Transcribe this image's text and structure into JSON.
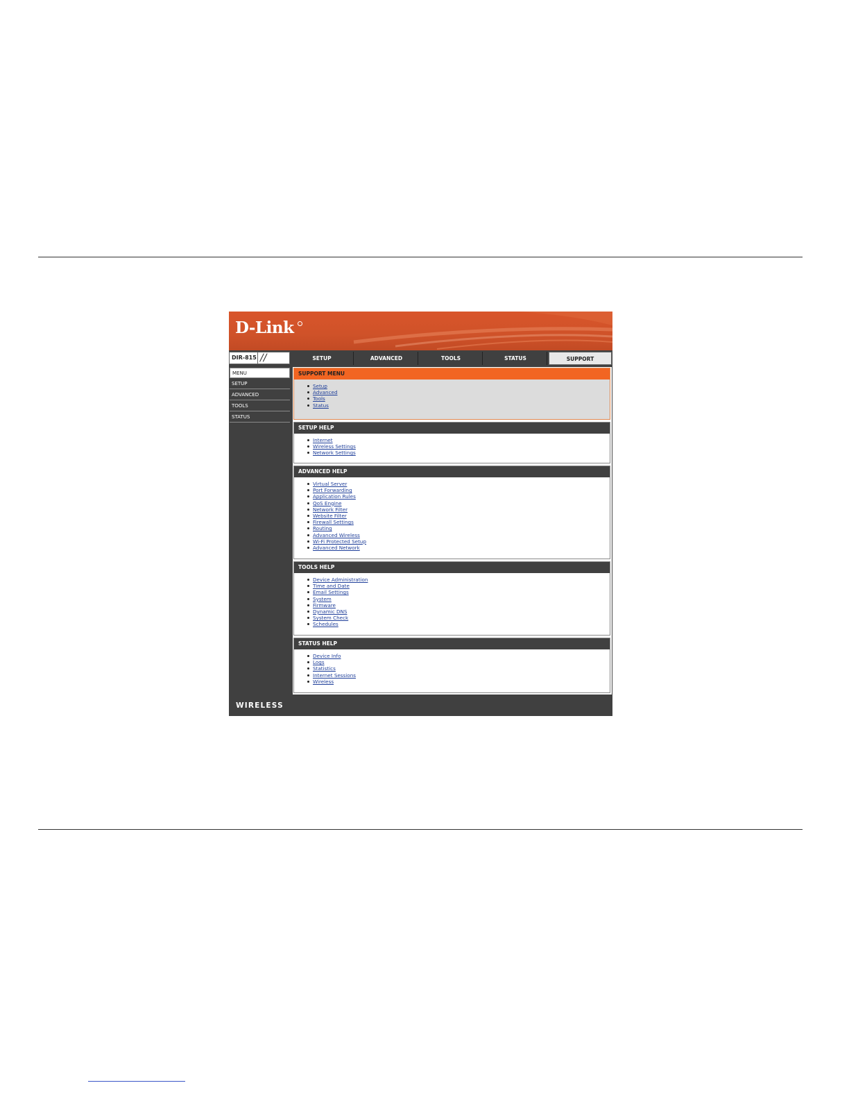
{
  "brand": {
    "logo": "D-Link",
    "model": "DIR-815",
    "footer": "WIRELESS"
  },
  "nav": {
    "tabs": [
      {
        "label": "SETUP",
        "active": false
      },
      {
        "label": "ADVANCED",
        "active": false
      },
      {
        "label": "TOOLS",
        "active": false
      },
      {
        "label": "STATUS",
        "active": false
      },
      {
        "label": "SUPPORT",
        "active": true
      }
    ]
  },
  "sidebar": {
    "items": [
      {
        "label": "MENU",
        "active": true
      },
      {
        "label": "SETUP",
        "active": false
      },
      {
        "label": "ADVANCED",
        "active": false
      },
      {
        "label": "TOOLS",
        "active": false
      },
      {
        "label": "STATUS",
        "active": false
      }
    ]
  },
  "sections": [
    {
      "title": "SUPPORT MENU",
      "links": [
        "Setup",
        "Advanced",
        "Tools",
        "Status"
      ]
    },
    {
      "title": "SETUP HELP",
      "links": [
        "Internet",
        "Wireless Settings",
        "Network Settings"
      ]
    },
    {
      "title": "ADVANCED HELP",
      "links": [
        "Virtual Server",
        "Port Forwarding",
        "Application Rules",
        "QoS Engine",
        "Network Filter",
        "Website Filter",
        "Firewall Settings",
        "Routing",
        "Advanced Wireless",
        "Wi-Fi Protected Setup",
        "Advanced Network"
      ]
    },
    {
      "title": "TOOLS HELP",
      "links": [
        "Device Administration",
        "Time and Date",
        "Email Settings",
        "System",
        "Firmware",
        "Dynamic DNS",
        "System Check",
        "Schedules"
      ]
    },
    {
      "title": "STATUS HELP",
      "links": [
        "Device Info",
        "Logs",
        "Statistics",
        "Internet Sessions",
        "Wireless"
      ]
    }
  ],
  "colors": {
    "accent": "#f26522",
    "dark": "#404040",
    "link": "#1f3f9a"
  }
}
